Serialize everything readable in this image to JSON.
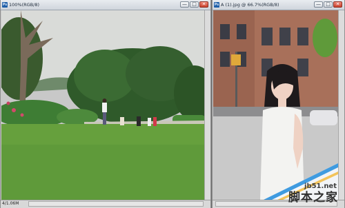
{
  "left_window": {
    "title": "100%(RGB/8)",
    "status": "4/1.06M",
    "photo": "park-lawn-with-trees"
  },
  "right_window": {
    "title": "A (1).jpg @ 66.7%(RGB/8)",
    "photo": "woman-in-white-dress-on-city-street"
  },
  "window_controls": {
    "minimize": "—",
    "restore": "□",
    "close": "✕"
  },
  "watermark": {
    "url": "jb51.net",
    "text": "脚本之家"
  }
}
